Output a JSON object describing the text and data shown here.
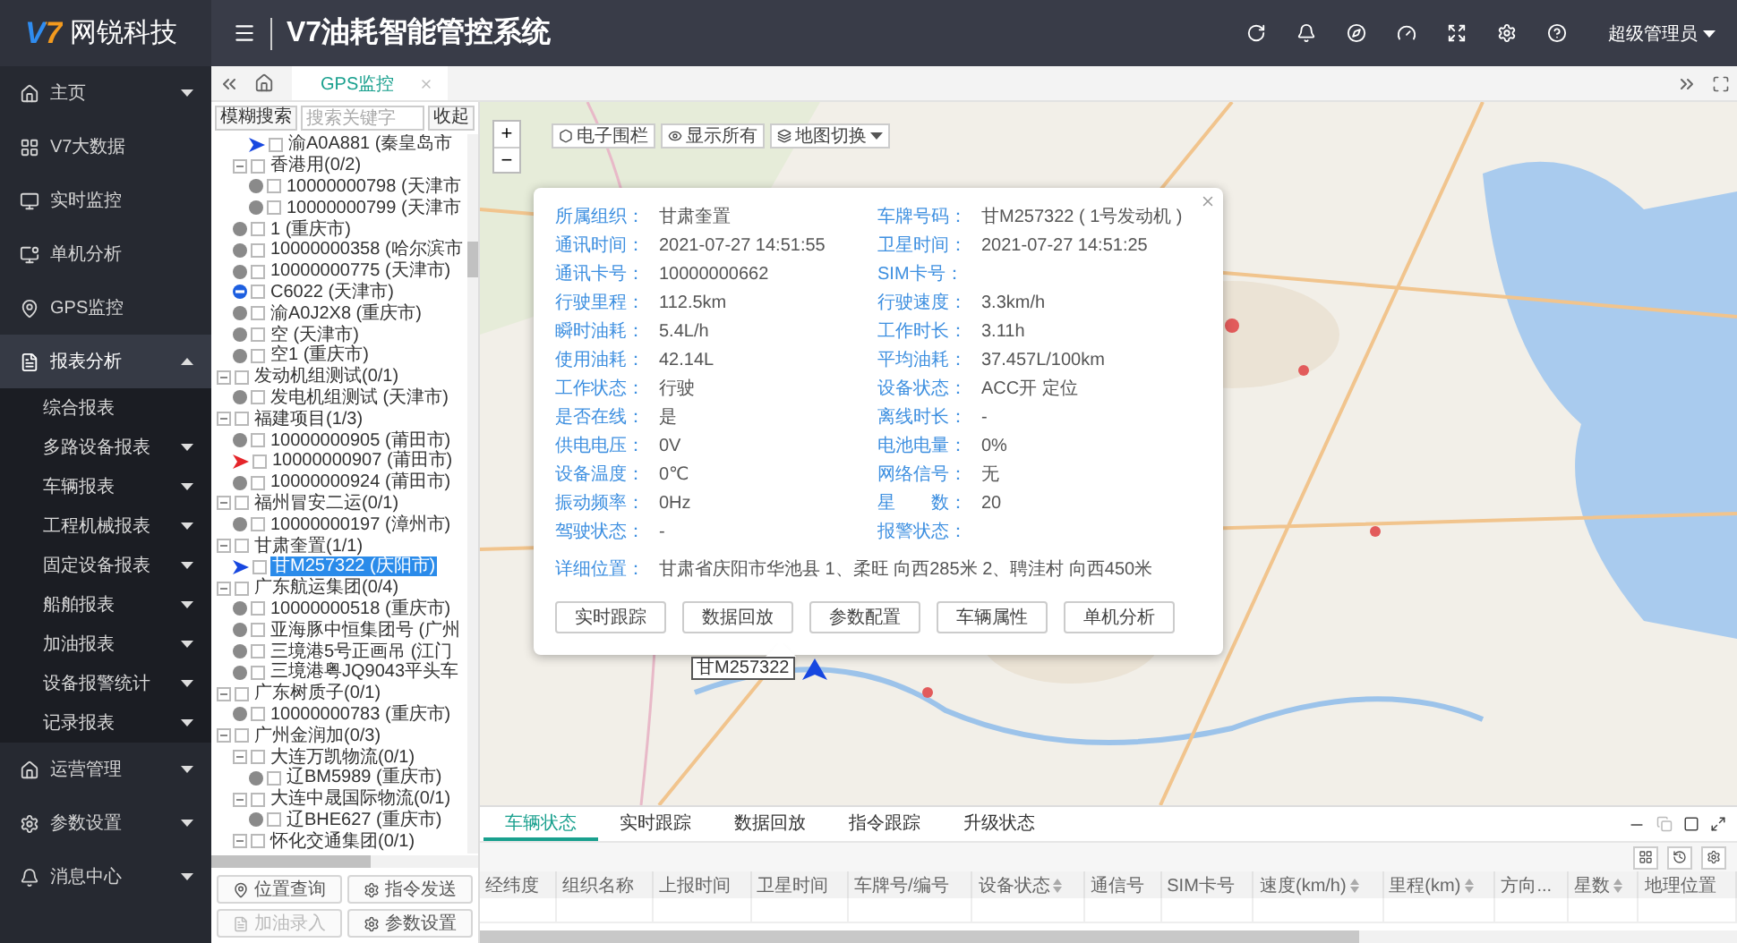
{
  "app": {
    "logo_mark": "V7",
    "logo_text": "网锐科技",
    "title": "V7油耗智能管控系统",
    "user": "超级管理员"
  },
  "sidebar": {
    "items": [
      {
        "label": "主页",
        "expanded": false,
        "selected": false
      },
      {
        "label": "V7大数据",
        "selected": false
      },
      {
        "label": "实时监控",
        "selected": false
      },
      {
        "label": "单机分析",
        "selected": false
      },
      {
        "label": "GPS监控",
        "selected": false
      },
      {
        "label": "报表分析",
        "expanded": true,
        "selected": true,
        "children": [
          {
            "label": "综合报表",
            "selected": false
          },
          {
            "label": "多路设备报表",
            "expanded": false,
            "selected": false
          },
          {
            "label": "车辆报表",
            "expanded": false,
            "selected": false
          },
          {
            "label": "工程机械报表",
            "expanded": false,
            "selected": false
          },
          {
            "label": "固定设备报表",
            "expanded": false,
            "selected": false
          },
          {
            "label": "船舶报表",
            "expanded": false,
            "selected": false
          },
          {
            "label": "加油报表",
            "expanded": false,
            "selected": false
          },
          {
            "label": "设备报警统计",
            "expanded": false,
            "selected": false
          },
          {
            "label": "记录报表",
            "expanded": false,
            "selected": false
          }
        ]
      },
      {
        "label": "运营管理",
        "expanded": false,
        "selected": false
      },
      {
        "label": "参数设置",
        "expanded": false,
        "selected": false
      },
      {
        "label": "消息中心",
        "expanded": false,
        "selected": false
      }
    ]
  },
  "page_tabs": [
    {
      "label": "GPS监控",
      "selected": true
    }
  ],
  "tree_panel": {
    "search_button": "模糊搜索",
    "search": {
      "placeholder": "搜索关键字"
    },
    "collapse_button": "收起",
    "tree": [
      {
        "children": [
          {
            "children": [
              {
                "label": "渝A0A881 (秦皇岛市",
                "kind": "moving",
                "checked": false,
                "selected": false
              }
            ]
          },
          {
            "label": "香港用(0/2)",
            "kind": "group",
            "expanded": true,
            "checked": false,
            "selected": false,
            "children": [
              {
                "label": "10000000798 (天津市",
                "kind": "offline",
                "checked": false,
                "selected": false
              },
              {
                "label": "10000000799 (天津市",
                "kind": "offline",
                "checked": false,
                "selected": false
              }
            ]
          },
          {
            "label": "1 (重庆市)",
            "kind": "offline",
            "checked": false,
            "selected": false
          },
          {
            "label": "10000000358 (哈尔滨市",
            "kind": "offline",
            "checked": false,
            "selected": false
          },
          {
            "label": "10000000775 (天津市)",
            "kind": "offline",
            "checked": false,
            "selected": false
          },
          {
            "label": "C6022 (天津市)",
            "kind": "stopped",
            "checked": false,
            "selected": false
          },
          {
            "label": "渝A0J2X8 (重庆市)",
            "kind": "offline",
            "checked": false,
            "selected": false
          },
          {
            "label": "空 (天津市)",
            "kind": "offline",
            "checked": false,
            "selected": false
          },
          {
            "label": "空1 (重庆市)",
            "kind": "offline",
            "checked": false,
            "selected": false
          }
        ]
      },
      {
        "label": "发动机组测试(0/1)",
        "kind": "group",
        "expanded": true,
        "checked": false,
        "selected": false,
        "children": [
          {
            "label": "发电机组测试 (天津市)",
            "kind": "offline",
            "checked": false,
            "selected": false
          }
        ]
      },
      {
        "label": "福建项目(1/3)",
        "kind": "group",
        "expanded": true,
        "checked": false,
        "selected": false,
        "children": [
          {
            "label": "10000000905 (莆田市)",
            "kind": "offline",
            "checked": false,
            "selected": false
          },
          {
            "label": "10000000907 (莆田市)",
            "kind": "alarm",
            "checked": false,
            "selected": false
          },
          {
            "label": "10000000924 (莆田市)",
            "kind": "offline",
            "checked": false,
            "selected": false
          }
        ]
      },
      {
        "label": "福州冒安二运(0/1)",
        "kind": "group",
        "expanded": true,
        "checked": false,
        "selected": false,
        "children": [
          {
            "label": "10000000197 (漳州市)",
            "kind": "offline",
            "checked": false,
            "selected": false
          }
        ]
      },
      {
        "label": "甘肃奎置(1/1)",
        "kind": "group",
        "expanded": true,
        "checked": false,
        "selected": false,
        "children": [
          {
            "label": "甘M257322 (庆阳市)",
            "kind": "moving",
            "checked": false,
            "selected": true
          }
        ]
      },
      {
        "label": "广东航运集团(0/4)",
        "kind": "group",
        "expanded": true,
        "checked": false,
        "selected": false,
        "children": [
          {
            "label": "10000000518 (重庆市)",
            "kind": "offline",
            "checked": false,
            "selected": false
          },
          {
            "label": "亚海豚中恒集团号 (广州",
            "kind": "offline",
            "checked": false,
            "selected": false
          },
          {
            "label": "三境港5号正画吊 (江门",
            "kind": "offline",
            "checked": false,
            "selected": false
          },
          {
            "label": "三境港粤JQ9043平头车",
            "kind": "offline",
            "checked": false,
            "selected": false
          }
        ]
      },
      {
        "label": "广东树质子(0/1)",
        "kind": "group",
        "expanded": true,
        "checked": false,
        "selected": false,
        "children": [
          {
            "label": "10000000783 (重庆市)",
            "kind": "offline",
            "checked": false,
            "selected": false
          }
        ]
      },
      {
        "label": "广州金润加(0/3)",
        "kind": "group",
        "expanded": true,
        "checked": false,
        "selected": false,
        "children": [
          {
            "label": "大连万凯物流(0/1)",
            "kind": "group",
            "expanded": true,
            "checked": false,
            "selected": false,
            "children": [
              {
                "label": "辽BM5989 (重庆市)",
                "kind": "offline",
                "checked": false,
                "selected": false
              }
            ]
          },
          {
            "label": "大连中晟国际物流(0/1)",
            "kind": "group",
            "expanded": true,
            "checked": false,
            "selected": false,
            "children": [
              {
                "label": "辽BHE627 (重庆市)",
                "kind": "offline",
                "checked": false,
                "selected": false
              }
            ]
          },
          {
            "label": "怀化交通集团(0/1)",
            "kind": "group",
            "expanded": true,
            "checked": false,
            "selected": false
          }
        ]
      }
    ],
    "buttons": [
      {
        "label": "位置查询",
        "disabled": false
      },
      {
        "label": "指令发送",
        "disabled": false
      },
      {
        "label": "加油录入",
        "disabled": true
      },
      {
        "label": "参数设置",
        "disabled": false
      }
    ]
  },
  "map": {
    "zoom_controls": [
      "+",
      "−"
    ],
    "tools": [
      {
        "label": "电子围栏",
        "kind": "button"
      },
      {
        "label": "显示所有",
        "kind": "button"
      },
      {
        "label": "地图切换",
        "kind": "menu"
      }
    ],
    "marker": {
      "label": "甘M257322"
    },
    "popup": {
      "fields": [
        {
          "label": "所属组织：",
          "value": "甘肃奎置"
        },
        {
          "label": "车牌号码：",
          "value": "甘M257322 ( 1号发动机 )"
        },
        {
          "label": "通讯时间：",
          "value": "2021-07-27 14:51:55"
        },
        {
          "label": "卫星时间：",
          "value": "2021-07-27 14:51:25"
        },
        {
          "label": "通讯卡号：",
          "value": "10000000662"
        },
        {
          "label": "SIM卡号："
        },
        {
          "label": "行驶里程：",
          "value": "112.5km"
        },
        {
          "label": "行驶速度：",
          "value": "3.3km/h"
        },
        {
          "label": "瞬时油耗：",
          "value": "5.4L/h"
        },
        {
          "label": "工作时长：",
          "value": "3.11h"
        },
        {
          "label": "使用油耗：",
          "value": "42.14L"
        },
        {
          "label": "平均油耗：",
          "value": "37.457L/100km"
        },
        {
          "label": "工作状态：",
          "value": "行驶"
        },
        {
          "label": "设备状态：",
          "value": "ACC开 定位"
        },
        {
          "label": "是否在线：",
          "value": "是"
        },
        {
          "label": "离线时长：",
          "value": "-"
        },
        {
          "label": "供电电压：",
          "value": "0V"
        },
        {
          "label": "电池电量：",
          "value": "0%"
        },
        {
          "label": "设备温度：",
          "value": "0℃"
        },
        {
          "label": "网络信号：",
          "value": "无"
        },
        {
          "label": "振动频率：",
          "value": "0Hz"
        },
        {
          "label": "星　　数：",
          "value": "20"
        },
        {
          "label": "驾驶状态：",
          "value": "-"
        },
        {
          "label": "报警状态："
        }
      ],
      "address": {
        "label": "详细位置：",
        "value": "甘肃省庆阳市华池县  1、柔旺 向西285米  2、聘洼村 向西450米"
      },
      "buttons": [
        "实时跟踪",
        "数据回放",
        "参数配置",
        "车辆属性",
        "单机分析"
      ]
    }
  },
  "bottom_panel": {
    "tabs": [
      {
        "label": "车辆状态",
        "selected": true
      },
      {
        "label": "实时跟踪",
        "selected": false
      },
      {
        "label": "数据回放",
        "selected": false
      },
      {
        "label": "指令跟踪",
        "selected": false
      },
      {
        "label": "升级状态",
        "selected": false
      }
    ],
    "columns": [
      {
        "label": "经纬度",
        "sortable": false
      },
      {
        "label": "组织名称",
        "sortable": false
      },
      {
        "label": "上报时间",
        "sortable": false
      },
      {
        "label": "卫星时间",
        "sortable": false
      },
      {
        "label": "车牌号/编号",
        "sortable": false
      },
      {
        "label": "设备状态",
        "sortable": true
      },
      {
        "label": "通信号",
        "sortable": false
      },
      {
        "label": "SIM卡号",
        "sortable": false
      },
      {
        "label": "速度(km/h)",
        "sortable": true
      },
      {
        "label": "里程(km)",
        "sortable": true
      },
      {
        "label": "方向...",
        "sortable": false
      },
      {
        "label": "星数",
        "sortable": true
      },
      {
        "label": "地理位置",
        "sortable": false
      }
    ]
  }
}
